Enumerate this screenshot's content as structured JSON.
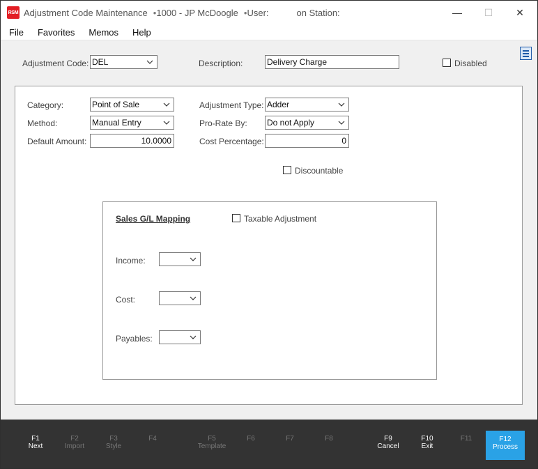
{
  "titlebar": {
    "app_logo": "RSM",
    "title": "Adjustment Code Maintenance",
    "sep1": "•",
    "user_code": "1000 - JP McDoogle",
    "sep2": "•",
    "user_label": "User:",
    "station_label": "on Station:",
    "minimize": "—",
    "maximize": "☐",
    "close": "✕"
  },
  "menu": {
    "items": [
      "File",
      "Favorites",
      "Memos",
      "Help"
    ]
  },
  "header": {
    "adjustment_code_label": "Adjustment Code:",
    "adjustment_code_value": "DEL",
    "description_label": "Description:",
    "description_value": "Delivery Charge",
    "disabled_label": "Disabled",
    "disabled_checked": false
  },
  "form": {
    "category_label": "Category:",
    "category_value": "Point of Sale",
    "method_label": "Method:",
    "method_value": "Manual Entry",
    "default_amount_label": "Default Amount:",
    "default_amount_value": "10.0000",
    "adjustment_type_label": "Adjustment Type:",
    "adjustment_type_value": "Adder",
    "pro_rate_label": "Pro-Rate By:",
    "pro_rate_value": "Do not Apply",
    "cost_percentage_label": "Cost Percentage:",
    "cost_percentage_value": "0",
    "discountable_label": "Discountable",
    "discountable_checked": false
  },
  "gl_mapping": {
    "title": "Sales G/L Mapping",
    "taxable_label": "Taxable Adjustment",
    "taxable_checked": false,
    "income_label": "Income:",
    "income_value": "",
    "cost_label": "Cost:",
    "cost_value": "",
    "payables_label": "Payables:",
    "payables_value": ""
  },
  "fkeys": [
    {
      "key": "F1",
      "name": "Next",
      "enabled": true
    },
    {
      "key": "F2",
      "name": "Import",
      "enabled": false
    },
    {
      "key": "F3",
      "name": "Style",
      "enabled": false
    },
    {
      "key": "F4",
      "name": "",
      "enabled": false
    },
    {
      "key": "F5",
      "name": "Template",
      "enabled": false
    },
    {
      "key": "F6",
      "name": "",
      "enabled": false
    },
    {
      "key": "F7",
      "name": "",
      "enabled": false
    },
    {
      "key": "F8",
      "name": "",
      "enabled": false
    },
    {
      "key": "F9",
      "name": "Cancel",
      "enabled": true
    },
    {
      "key": "F10",
      "name": "Exit",
      "enabled": true
    },
    {
      "key": "F11",
      "name": "",
      "enabled": false
    },
    {
      "key": "F12",
      "name": "Process",
      "enabled": true
    }
  ],
  "colors": {
    "process_button": "#2aa2e6",
    "fkey_bar": "#333333",
    "logo": "#e31e24"
  }
}
